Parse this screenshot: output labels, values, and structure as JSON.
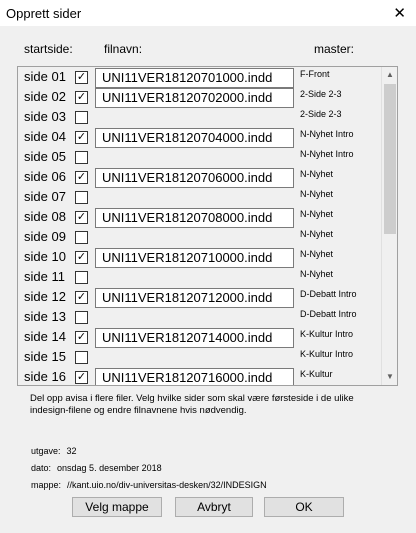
{
  "window": {
    "title": "Opprett sider",
    "close_glyph": "✕"
  },
  "headers": {
    "startside": "startside:",
    "filnavn": "filnavn:",
    "master": "master:"
  },
  "rows": [
    {
      "label": "side 01",
      "checked": true,
      "file": "UNI11VER18120701000.indd",
      "master": "F-Front"
    },
    {
      "label": "side 02",
      "checked": true,
      "file": "UNI11VER18120702000.indd",
      "master": "2-Side 2-3"
    },
    {
      "label": "side 03",
      "checked": false,
      "file": "",
      "master": "2-Side 2-3"
    },
    {
      "label": "side 04",
      "checked": true,
      "file": "UNI11VER18120704000.indd",
      "master": "N-Nyhet Intro"
    },
    {
      "label": "side 05",
      "checked": false,
      "file": "",
      "master": "N-Nyhet Intro"
    },
    {
      "label": "side 06",
      "checked": true,
      "file": "UNI11VER18120706000.indd",
      "master": "N-Nyhet"
    },
    {
      "label": "side 07",
      "checked": false,
      "file": "",
      "master": "N-Nyhet"
    },
    {
      "label": "side 08",
      "checked": true,
      "file": "UNI11VER18120708000.indd",
      "master": "N-Nyhet"
    },
    {
      "label": "side 09",
      "checked": false,
      "file": "",
      "master": "N-Nyhet"
    },
    {
      "label": "side 10",
      "checked": true,
      "file": "UNI11VER18120710000.indd",
      "master": "N-Nyhet"
    },
    {
      "label": "side 11",
      "checked": false,
      "file": "",
      "master": "N-Nyhet"
    },
    {
      "label": "side 12",
      "checked": true,
      "file": "UNI11VER18120712000.indd",
      "master": "D-Debatt Intro"
    },
    {
      "label": "side 13",
      "checked": false,
      "file": "",
      "master": "D-Debatt Intro"
    },
    {
      "label": "side 14",
      "checked": true,
      "file": "UNI11VER18120714000.indd",
      "master": "K-Kultur Intro"
    },
    {
      "label": "side 15",
      "checked": false,
      "file": "",
      "master": "K-Kultur Intro"
    },
    {
      "label": "side 16",
      "checked": true,
      "file": "UNI11VER18120716000.indd",
      "master": "K-Kultur"
    }
  ],
  "scrollbar": {
    "up_glyph": "▲",
    "down_glyph": "▼"
  },
  "description": "Del opp avisa i flere filer. Velg hvilke sider som skal være førsteside i de ulike indesign-filene og endre filnavnene hvis nødvendig.",
  "info": {
    "utgave_label": "utgave:",
    "utgave_value": "32",
    "dato_label": "dato:",
    "dato_value": "onsdag 5. desember 2018",
    "mappe_label": "mappe:",
    "mappe_value": "//kant.uio.no/div-universitas-desken/32/INDESIGN"
  },
  "buttons": {
    "velg_mappe": "Velg mappe",
    "avbryt": "Avbryt",
    "ok": "OK"
  },
  "check_glyph": "✓"
}
